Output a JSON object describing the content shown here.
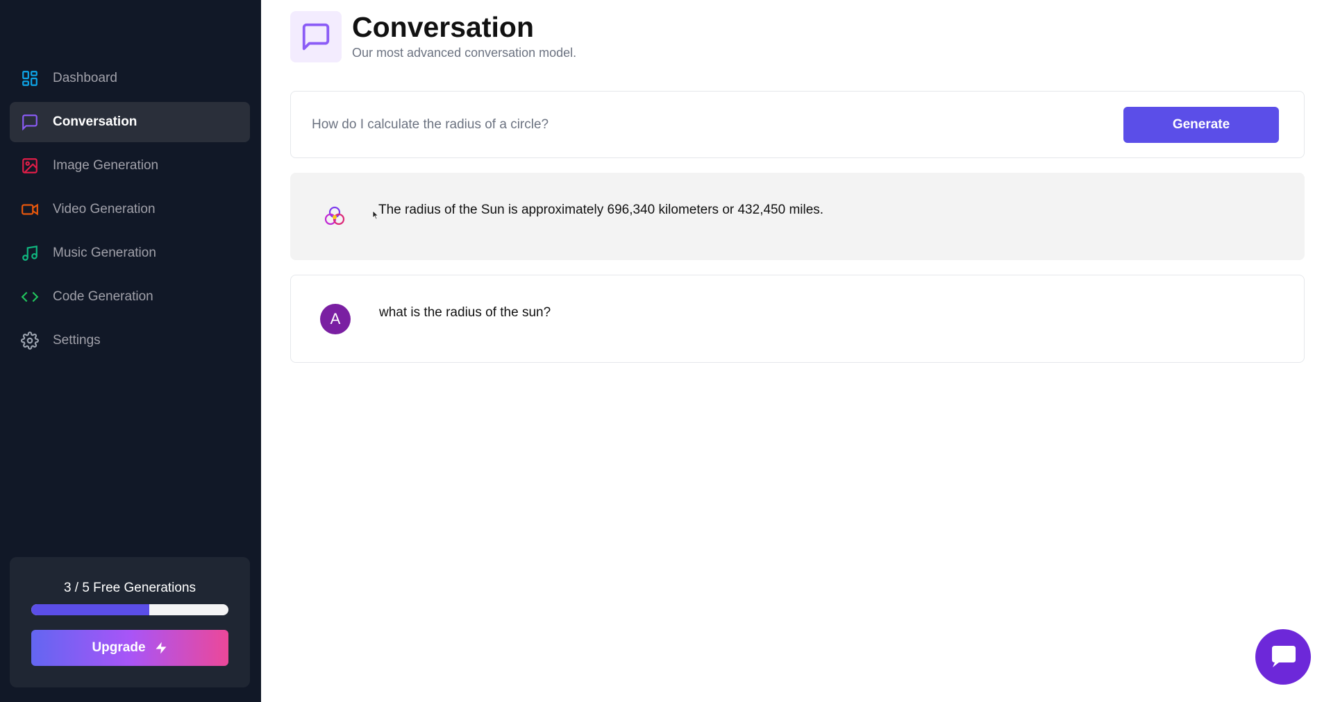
{
  "sidebar": {
    "items": [
      {
        "label": "Dashboard",
        "icon": "dashboard-icon",
        "color": "#0ea5e9"
      },
      {
        "label": "Conversation",
        "icon": "message-square-icon",
        "color": "#8b5cf6"
      },
      {
        "label": "Image Generation",
        "icon": "image-icon",
        "color": "#e11d48"
      },
      {
        "label": "Video Generation",
        "icon": "video-icon",
        "color": "#ea580c"
      },
      {
        "label": "Music Generation",
        "icon": "music-icon",
        "color": "#10b981"
      },
      {
        "label": "Code Generation",
        "icon": "code-icon",
        "color": "#22c55e"
      },
      {
        "label": "Settings",
        "icon": "gear-icon",
        "color": "#9ca3af"
      }
    ],
    "active_item": "Conversation",
    "credits": {
      "text": "3 / 5 Free Generations",
      "used": 3,
      "total": 5,
      "progress_fraction": 0.6,
      "upgrade_label": "Upgrade"
    }
  },
  "header": {
    "title": "Conversation",
    "subtitle": "Our most advanced conversation model."
  },
  "prompt": {
    "placeholder": "How do I calculate the radius of a circle?",
    "generate_label": "Generate"
  },
  "messages": [
    {
      "role": "bot",
      "text": "The radius of the Sun is approximately 696,340 kilometers or 432,450 miles."
    },
    {
      "role": "user",
      "avatar_letter": "A",
      "text": "what is the radius of the sun?"
    }
  ],
  "colors": {
    "sidebar_bg": "#111827",
    "accent": "#5b4ee8",
    "user_avatar": "#7a1fa2",
    "chat_bubble": "#6d28d9"
  }
}
